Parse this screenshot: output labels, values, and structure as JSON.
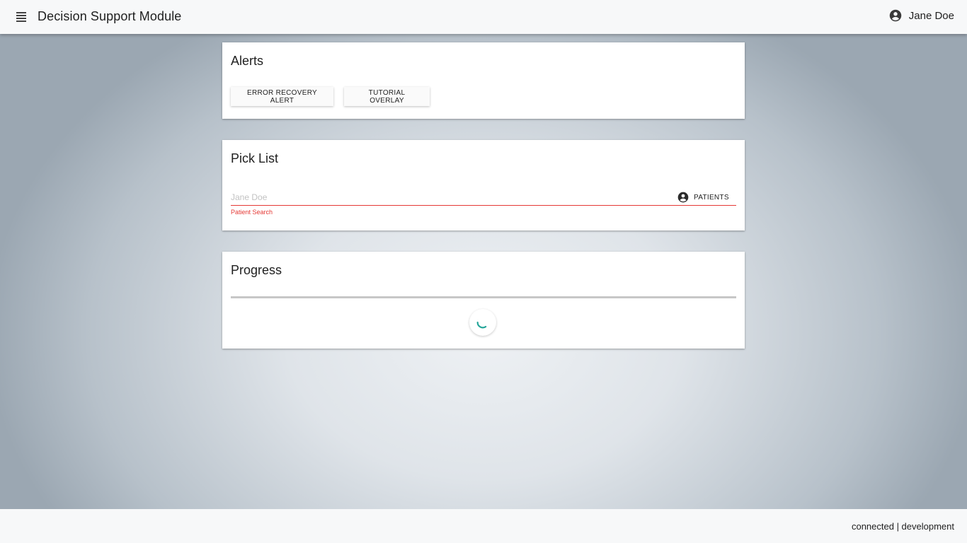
{
  "appbar": {
    "title": "Decision Support Module",
    "menu_icon": "menu-icon",
    "user": {
      "name": "Jane Doe",
      "icon": "account-circle-icon"
    }
  },
  "alerts_card": {
    "title": "Alerts",
    "buttons": [
      {
        "label": "ERROR RECOVERY ALERT"
      },
      {
        "label": "TUTORIAL OVERLAY"
      }
    ]
  },
  "picklist_card": {
    "title": "Pick List",
    "search": {
      "placeholder": "Jane Doe",
      "value": "",
      "helper": "Patient Search"
    },
    "patients_button": {
      "label": "PATIENTS",
      "icon": "account-circle-icon"
    }
  },
  "progress_card": {
    "title": "Progress",
    "progress_value": 0,
    "spinner_icon": "loading-spinner-icon"
  },
  "footer": {
    "status": "connected | development"
  },
  "colors": {
    "accent": "#26a69a",
    "error": "#e53935",
    "surface": "#ffffff",
    "bar": "#f7f8f9"
  }
}
